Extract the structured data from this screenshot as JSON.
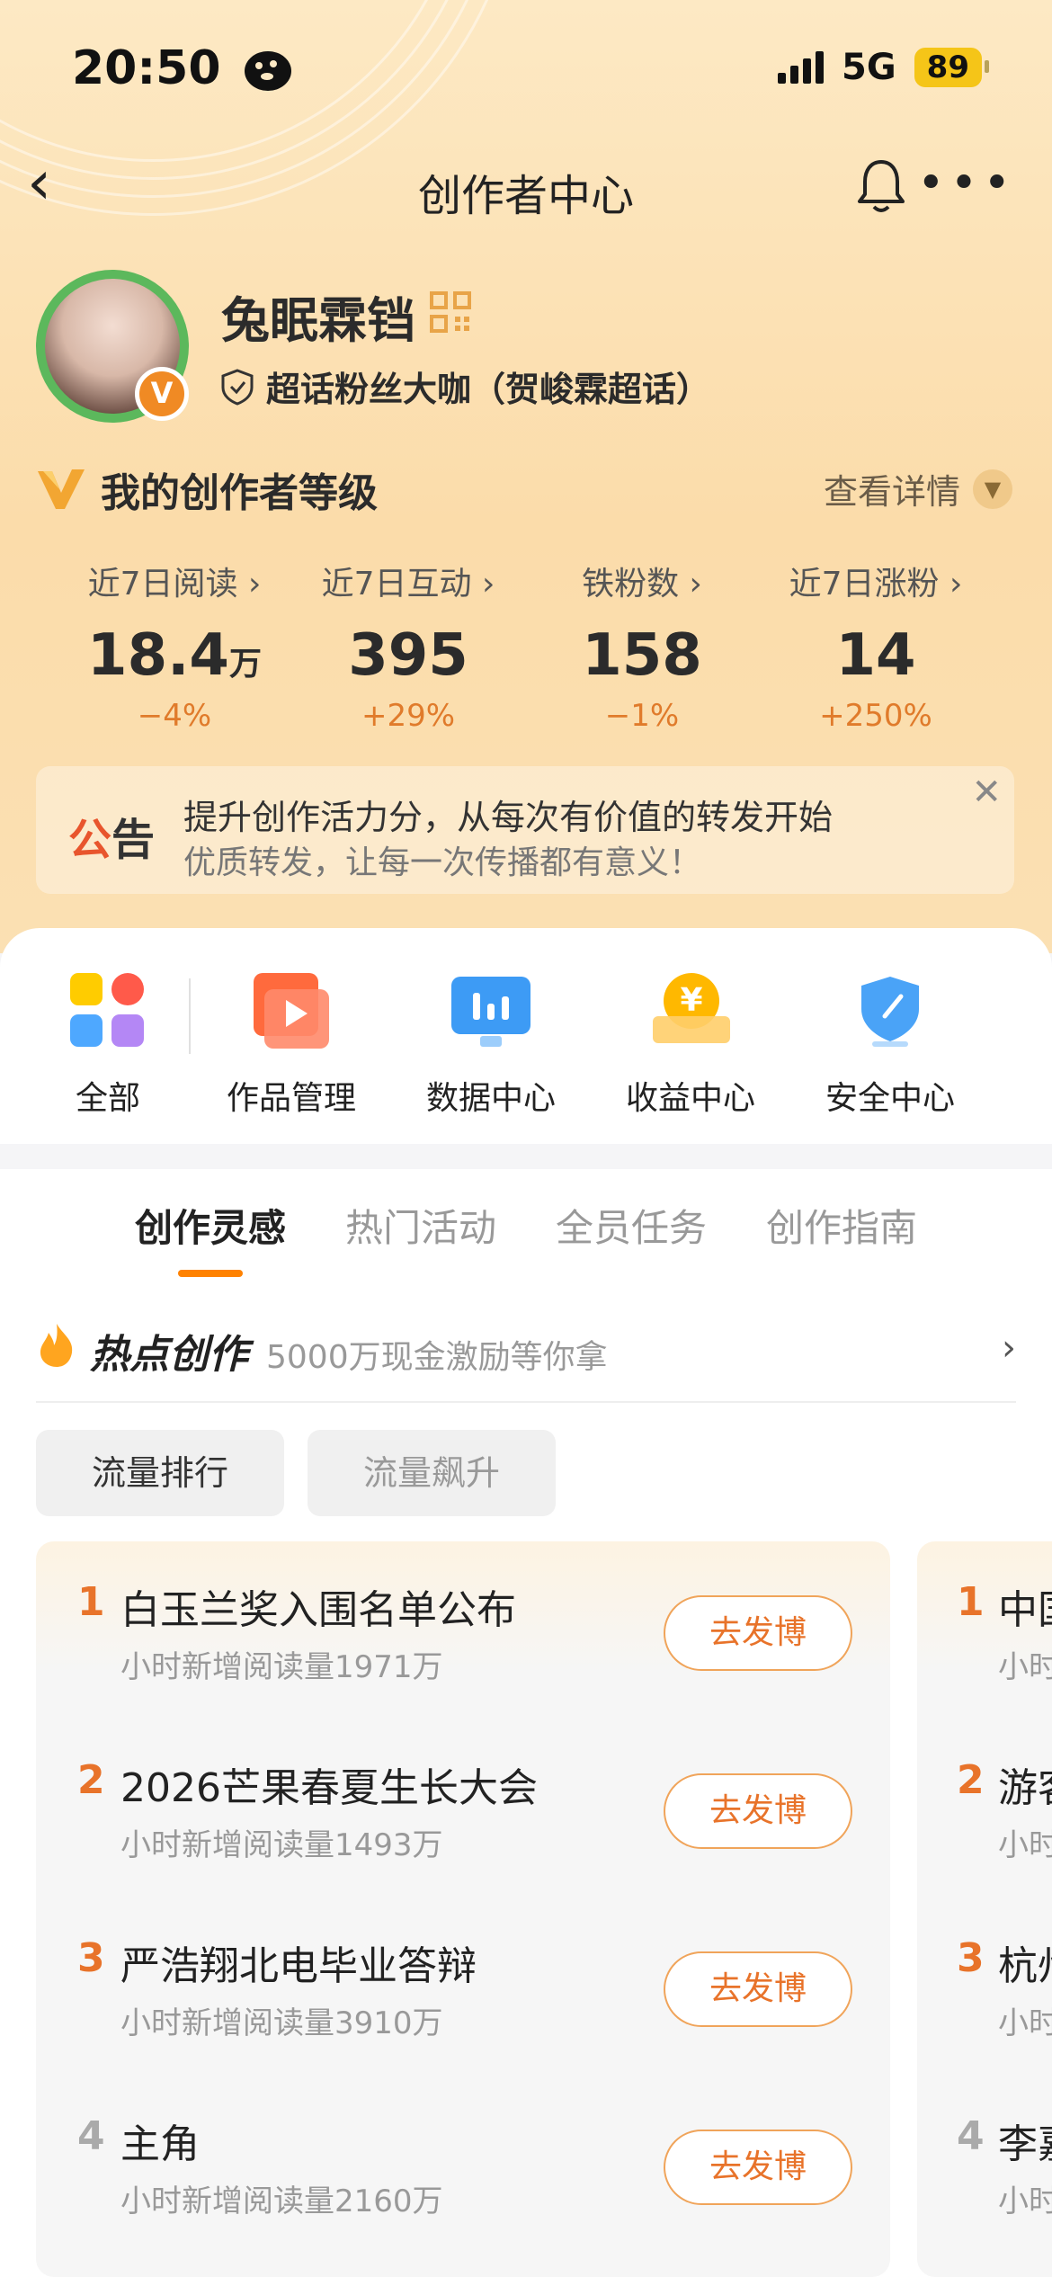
{
  "status_bar": {
    "time": "20:50",
    "network": "5G",
    "battery": "89"
  },
  "nav": {
    "title": "创作者中心"
  },
  "profile": {
    "name": "兔眠霖铛",
    "fan_title": "超话粉丝大咖（贺峻霖超话）",
    "badge": "V"
  },
  "level": {
    "title": "我的创作者等级",
    "detail_link": "查看详情"
  },
  "stats": [
    {
      "label": "近7日阅读 ›",
      "value": "18.4",
      "unit": "万",
      "change": "−4%"
    },
    {
      "label": "近7日互动 ›",
      "value": "395",
      "unit": "",
      "change": "+29%"
    },
    {
      "label": "铁粉数 ›",
      "value": "158",
      "unit": "",
      "change": "−1%"
    },
    {
      "label": "近7日涨粉 ›",
      "value": "14",
      "unit": "",
      "change": "+250%"
    }
  ],
  "notice": {
    "tag_a": "公",
    "tag_b": "告",
    "headline": "提升创作活力分，从每次有价值的转发开始",
    "sub": "优质转发，让每一次传播都有意义！"
  },
  "tools": [
    {
      "label": "全部",
      "icon": "grid-icon"
    },
    {
      "label": "作品管理",
      "icon": "play-folder-icon"
    },
    {
      "label": "数据中心",
      "icon": "chart-monitor-icon"
    },
    {
      "label": "收益中心",
      "icon": "yuan-coin-icon"
    },
    {
      "label": "安全中心",
      "icon": "shield-icon"
    }
  ],
  "tabs": [
    "创作灵感",
    "热门活动",
    "全员任务",
    "创作指南"
  ],
  "hot": {
    "title": "热点创作",
    "subtitle": "5000万现金激励等你拿"
  },
  "filters": [
    "流量排行",
    "流量飙升"
  ],
  "trending": [
    {
      "rank": "1",
      "title": "白玉兰奖入围名单公布",
      "sub": "小时新增阅读量1971万",
      "action": "去发博"
    },
    {
      "rank": "2",
      "title": "2026芒果春夏生长大会",
      "sub": "小时新增阅读量1493万",
      "action": "去发博"
    },
    {
      "rank": "3",
      "title": "严浩翔北电毕业答辩",
      "sub": "小时新增阅读量3910万",
      "action": "去发博"
    },
    {
      "rank": "4",
      "title": "主角",
      "sub": "小时新增阅读量2160万",
      "action": "去发博"
    }
  ],
  "trending_b": [
    {
      "rank": "1",
      "title": "中国",
      "sub": "小时"
    },
    {
      "rank": "2",
      "title": "游客",
      "sub": "小时"
    },
    {
      "rank": "3",
      "title": "杭州",
      "sub": "小时"
    },
    {
      "rank": "4",
      "title": "李嘉",
      "sub": "小时"
    }
  ],
  "colors": {
    "accent": "#ff8200",
    "rank_top": "#e8732a",
    "hero_bg": "#fbdcaa"
  }
}
